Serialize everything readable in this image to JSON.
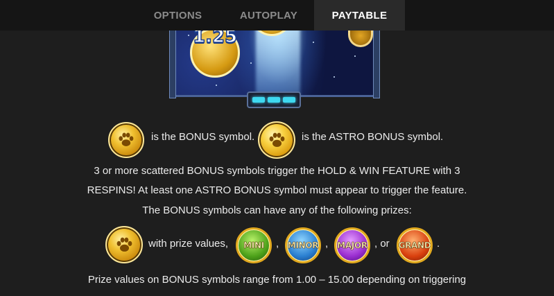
{
  "tabs": [
    {
      "label": "OPTIONS",
      "active": false
    },
    {
      "label": "AUTOPLAY",
      "active": false
    },
    {
      "label": "PAYTABLE",
      "active": true
    }
  ],
  "preview": {
    "coin_value": "1.25"
  },
  "symbols_line": {
    "bonus_text": "is the BONUS symbol.",
    "astro_text": "is the ASTRO BONUS symbol.",
    "bonus_icon": "bonus-paw-coin-icon",
    "astro_icon": "astro-bonus-paw-coin-icon"
  },
  "paragraph": {
    "line1": "3 or more scattered BONUS symbols trigger the HOLD & WIN FEATURE with 3",
    "line2": "RESPINS! At least one ASTRO BONUS symbol must appear to trigger the feature.",
    "line3": "The BONUS symbols can have any of the following prizes:"
  },
  "prizes": {
    "with_text": "with prize values,",
    "sep1": ",",
    "sep2": ",",
    "sep3": ", or",
    "end": ".",
    "items": [
      {
        "label": "MINI",
        "color": "#4da11a"
      },
      {
        "label": "MINOR",
        "color": "#2a7fd0"
      },
      {
        "label": "MAJOR",
        "color": "#9a2ed0"
      },
      {
        "label": "GRAND",
        "color": "#d9400e"
      }
    ]
  },
  "footer": {
    "line": "Prize values on BONUS symbols range from 1.00 – 15.00 depending on triggering"
  }
}
